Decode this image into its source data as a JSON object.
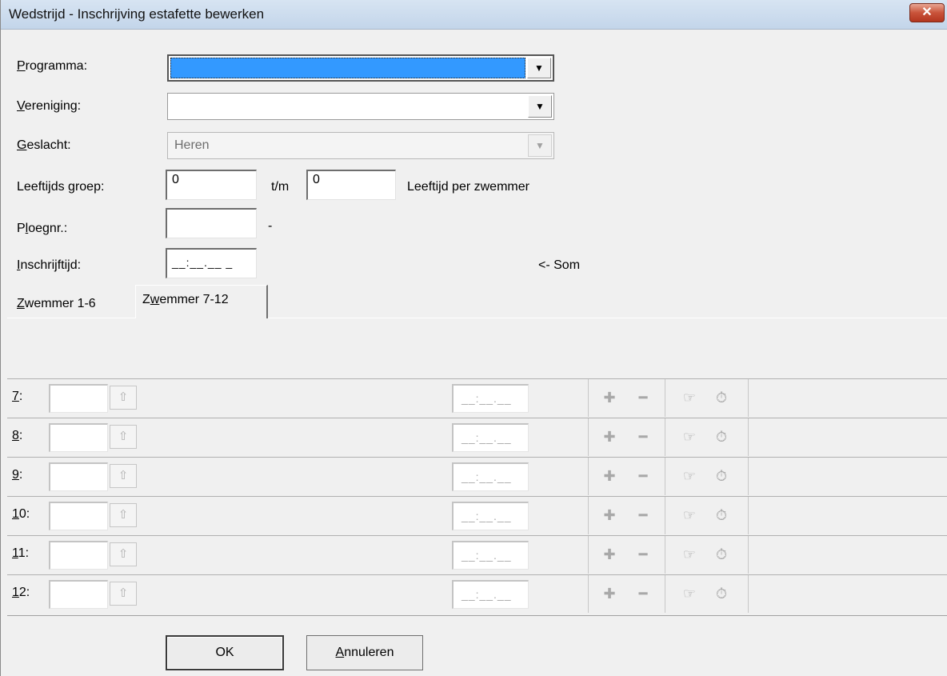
{
  "window": {
    "title": "Wedstrijd - Inschrijving estafette bewerken",
    "close_glyph": "✕"
  },
  "form": {
    "programma": {
      "label_first": "P",
      "label_rest": "rogramma:",
      "value": ""
    },
    "vereniging": {
      "label_first": "V",
      "label_rest": "ereniging:",
      "value": ""
    },
    "geslacht": {
      "label_first": "G",
      "label_rest": "eslacht:",
      "value": "Heren"
    },
    "leeftijd": {
      "label": "Leeftijds groep:",
      "from": "0",
      "sep": "t/m",
      "to": "0",
      "note": "Leeftijd per zwemmer"
    },
    "ploegnr": {
      "label_pre": "P",
      "label_first": "l",
      "label_rest": "oegnr.:",
      "value": "",
      "suffix": "-"
    },
    "inschrijftijd": {
      "label_first": "I",
      "label_rest": "nschrijftijd:",
      "value": "__:__.__ _",
      "note": "<- Som"
    }
  },
  "tabs": [
    {
      "first": "Z",
      "rest": "wemmer 1-6"
    },
    {
      "pre": "Z",
      "first": "w",
      "rest": "emmer 7-12"
    }
  ],
  "swimmers": [
    {
      "num_first": "7",
      "num_rest": ":"
    },
    {
      "num_first": "8",
      "num_rest": ":"
    },
    {
      "num_first": "9",
      "num_rest": ":"
    },
    {
      "num_first": "1",
      "num_rest": "0:"
    },
    {
      "num_first": "1",
      "num_rest": "1:"
    },
    {
      "num_first": "1",
      "num_rest": "2:"
    }
  ],
  "row_time_placeholder": "__:__.__",
  "icons": {
    "up": "⇧",
    "plus": "✚",
    "minus": "━",
    "hand": "☞",
    "stopwatch": "⏱"
  },
  "buttons": {
    "ok": "OK",
    "cancel_first": "A",
    "cancel_rest": "nnuleren"
  },
  "colors": {
    "selection": "#3399ff",
    "titlebar": "#c9d9ec",
    "close": "#c9533a"
  }
}
